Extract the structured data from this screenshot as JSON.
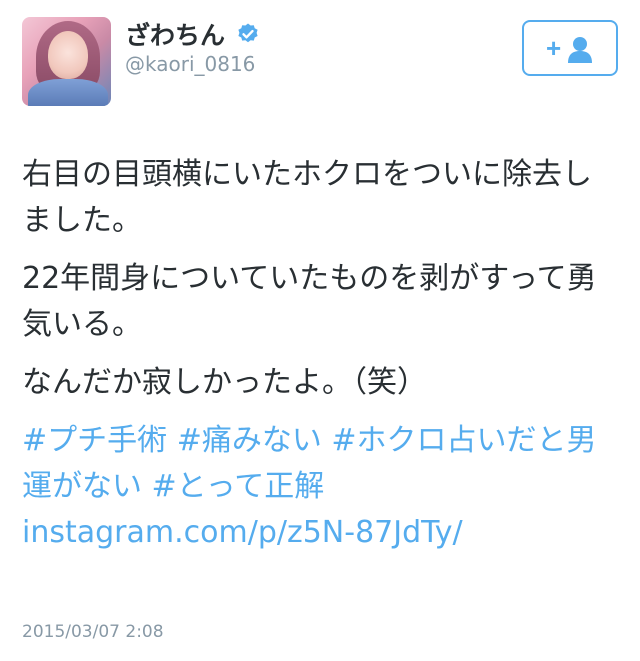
{
  "user": {
    "display_name": "ざわちん",
    "handle": "@kaori_0816",
    "verified": true
  },
  "follow_button": {
    "icon": "add-user-icon",
    "symbol": "+"
  },
  "tweet": {
    "paragraphs": [
      "右目の目頭横にいたホクロをついに除去しました。",
      "22年間身についていたものを剥がすって勇気いる。",
      "なんだか寂しかったよ。（笑）"
    ],
    "hashtags": [
      "#プチ手術",
      "#痛みない",
      "#ホクロ占いだと男運がない",
      "#とって正解"
    ],
    "link": "instagram.com/p/z5N-87JdTy/",
    "timestamp": "2015/03/07 2:08"
  },
  "colors": {
    "accent": "#55acee",
    "text": "#292f33",
    "muted": "#8899a6"
  }
}
